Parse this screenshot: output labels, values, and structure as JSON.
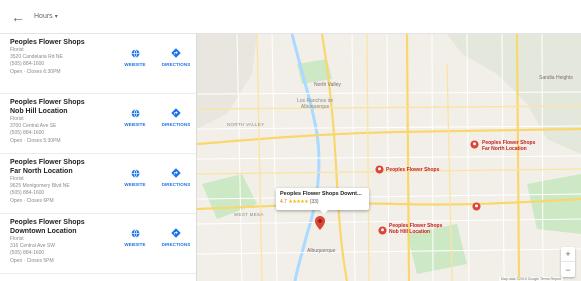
{
  "topbar": {
    "back_icon": "arrow-left-icon",
    "hours_label": "Hours",
    "hours_caret": "▾"
  },
  "actions": {
    "website_label": "WEBSITE",
    "directions_label": "DIRECTIONS"
  },
  "results": [
    {
      "name_line1": "Peoples Flower Shops",
      "name_line2": "",
      "category": "Florist",
      "address": "3520 Candelaria Rd NE",
      "phone": "(505) 884-1600",
      "hours": "Open · Closes 6:30PM"
    },
    {
      "name_line1": "Peoples Flower Shops",
      "name_line2": "Nob Hill Location",
      "category": "Florist",
      "address": "3700 Central Ave SE",
      "phone": "(505) 884-1600",
      "hours": "Open · Closes 5:30PM"
    },
    {
      "name_line1": "Peoples Flower Shops",
      "name_line2": "Far North Location",
      "category": "Florist",
      "address": "9625 Montgomery Blvd NE",
      "phone": "(505) 884-1600",
      "hours": "Open · Closes 6PM"
    },
    {
      "name_line1": "Peoples Flower Shops",
      "name_line2": "Downtown Location",
      "category": "Florist",
      "address": "316 Central Ave SW",
      "phone": "(505) 884-1600",
      "hours": "Open · Closes 5PM"
    }
  ],
  "map": {
    "places": {
      "north_valley": "North Valley",
      "los_ranchos": "Los Ranchos de\nAlbuquerque",
      "sandia_heights": "Sandia Heights",
      "albuquerque": "Albuquerque"
    },
    "roads": {
      "west_mesa": "WEST MESA",
      "north_valley_road": "NORTH VALLEY"
    },
    "pins": [
      {
        "label": "Peoples Flower Shops\nFar North Location"
      },
      {
        "label": "Peoples Flower Shops"
      },
      {
        "label": "Peoples Flower Shops\nNob Hill Location"
      },
      {
        "label": ""
      },
      {
        "label": ""
      }
    ],
    "callout": {
      "title": "Peoples Flower Shops Downt...",
      "rating": "4.7",
      "stars": "★★★★★",
      "count": "(33)"
    },
    "zoom_in": "+",
    "zoom_out": "−",
    "attribution": "Map data ©2019 Google  Terms  Report"
  },
  "colors": {
    "pin_red": "#db4437",
    "link_blue": "#1a73e8",
    "road_yellow": "#f9d76c",
    "park_green": "#cde8c5",
    "water_blue": "#aadaff"
  }
}
